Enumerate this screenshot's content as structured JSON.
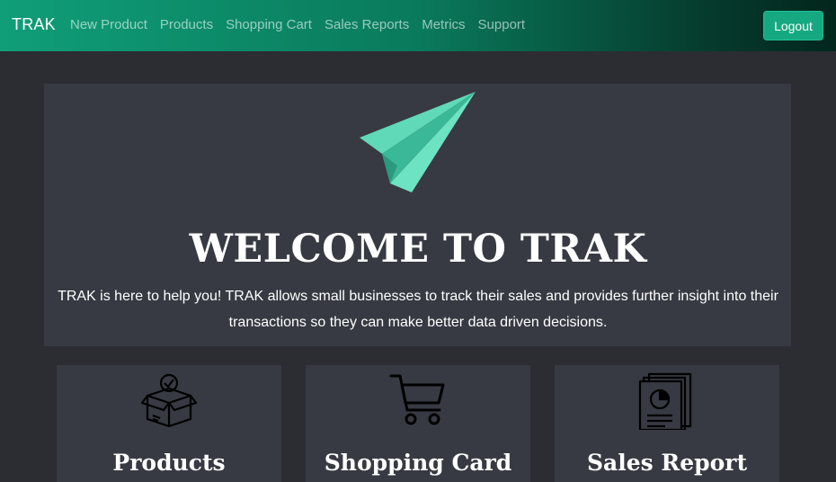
{
  "navbar": {
    "brand": "TRAK",
    "links": [
      "New Product",
      "Products",
      "Shopping Cart",
      "Sales Reports",
      "Metrics",
      "Support"
    ],
    "logout_label": "Logout",
    "accent_color": "#16a981"
  },
  "hero": {
    "icon": "paper-plane-icon",
    "title": "WELCOME TO TRAK",
    "text": "TRAK is here to help you! TRAK allows small businesses to track their sales and provides further insight into their transactions so they can make better data driven decisions."
  },
  "cards": [
    {
      "icon": "box-check-icon",
      "title": "Products"
    },
    {
      "icon": "shopping-cart-icon",
      "title": "Shopping Card"
    },
    {
      "icon": "report-chart-icon",
      "title": "Sales Report"
    }
  ]
}
